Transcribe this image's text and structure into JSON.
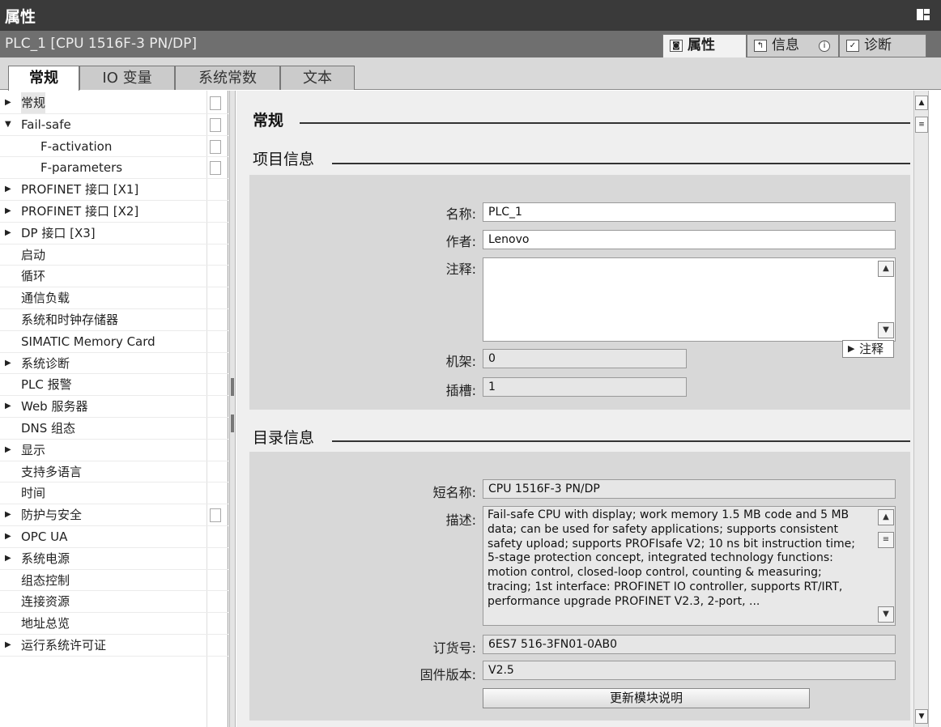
{
  "window": {
    "title": "属性"
  },
  "object_bar": {
    "object_name": "PLC_1 [CPU 1516F-3 PN/DP]",
    "tabs": [
      {
        "label": "属性",
        "icon": "properties-icon",
        "active": true
      },
      {
        "label": "信息",
        "icon": "info-icon",
        "active": false
      },
      {
        "label": "诊断",
        "icon": "diagnostics-icon",
        "active": false
      }
    ]
  },
  "tabs": [
    {
      "label": "常规",
      "active": true
    },
    {
      "label": "IO 变量",
      "active": false
    },
    {
      "label": "系统常数",
      "active": false
    },
    {
      "label": "文本",
      "active": false
    }
  ],
  "nav": {
    "items": [
      {
        "label": "常规",
        "arrow": "▶",
        "indent": 1,
        "selected": true,
        "checkbox": true
      },
      {
        "label": "Fail-safe",
        "arrow": "▼",
        "indent": 1,
        "selected": false,
        "checkbox": true
      },
      {
        "label": "F-activation",
        "arrow": "",
        "indent": 3,
        "selected": false,
        "checkbox": true
      },
      {
        "label": "F-parameters",
        "arrow": "",
        "indent": 3,
        "selected": false,
        "checkbox": true
      },
      {
        "label": "PROFINET 接口 [X1]",
        "arrow": "▶",
        "indent": 1,
        "selected": false,
        "checkbox": false
      },
      {
        "label": "PROFINET 接口 [X2]",
        "arrow": "▶",
        "indent": 1,
        "selected": false,
        "checkbox": false
      },
      {
        "label": "DP 接口 [X3]",
        "arrow": "▶",
        "indent": 1,
        "selected": false,
        "checkbox": false
      },
      {
        "label": "启动",
        "arrow": "",
        "indent": 2,
        "selected": false,
        "checkbox": false
      },
      {
        "label": "循环",
        "arrow": "",
        "indent": 2,
        "selected": false,
        "checkbox": false
      },
      {
        "label": "通信负载",
        "arrow": "",
        "indent": 2,
        "selected": false,
        "checkbox": false
      },
      {
        "label": "系统和时钟存储器",
        "arrow": "",
        "indent": 2,
        "selected": false,
        "checkbox": false
      },
      {
        "label": "SIMATIC Memory Card",
        "arrow": "",
        "indent": 2,
        "selected": false,
        "checkbox": false
      },
      {
        "label": "系统诊断",
        "arrow": "▶",
        "indent": 1,
        "selected": false,
        "checkbox": false
      },
      {
        "label": "PLC 报警",
        "arrow": "",
        "indent": 2,
        "selected": false,
        "checkbox": false
      },
      {
        "label": "Web 服务器",
        "arrow": "▶",
        "indent": 1,
        "selected": false,
        "checkbox": false
      },
      {
        "label": "DNS 组态",
        "arrow": "",
        "indent": 2,
        "selected": false,
        "checkbox": false
      },
      {
        "label": "显示",
        "arrow": "▶",
        "indent": 1,
        "selected": false,
        "checkbox": false
      },
      {
        "label": "支持多语言",
        "arrow": "",
        "indent": 2,
        "selected": false,
        "checkbox": false
      },
      {
        "label": "时间",
        "arrow": "",
        "indent": 2,
        "selected": false,
        "checkbox": false
      },
      {
        "label": "防护与安全",
        "arrow": "▶",
        "indent": 1,
        "selected": false,
        "checkbox": true
      },
      {
        "label": "OPC UA",
        "arrow": "▶",
        "indent": 1,
        "selected": false,
        "checkbox": false
      },
      {
        "label": "系统电源",
        "arrow": "▶",
        "indent": 1,
        "selected": false,
        "checkbox": false
      },
      {
        "label": "组态控制",
        "arrow": "",
        "indent": 2,
        "selected": false,
        "checkbox": false
      },
      {
        "label": "连接资源",
        "arrow": "",
        "indent": 2,
        "selected": false,
        "checkbox": false
      },
      {
        "label": "地址总览",
        "arrow": "",
        "indent": 2,
        "selected": false,
        "checkbox": false
      },
      {
        "label": "运行系统许可证",
        "arrow": "▶",
        "indent": 1,
        "selected": false,
        "checkbox": false
      }
    ]
  },
  "content": {
    "section_title": "常规",
    "project_info": {
      "heading": "项目信息",
      "name_label": "名称:",
      "name_value": "PLC_1",
      "author_label": "作者:",
      "author_value": "Lenovo",
      "comment_label": "注释:",
      "comment_value": "",
      "comment_button": "注释",
      "rack_label": "机架:",
      "rack_value": "0",
      "slot_label": "插槽:",
      "slot_value": "1"
    },
    "catalog_info": {
      "heading": "目录信息",
      "short_name_label": "短名称:",
      "short_name_value": "CPU 1516F-3 PN/DP",
      "description_label": "描述:",
      "description_value": "Fail-safe CPU with display; work memory 1.5 MB code and 5 MB data; can be used for safety applications; supports consistent safety upload; supports PROFIsafe V2; 10 ns bit instruction time; 5-stage protection concept, integrated technology functions: motion control, closed-loop control, counting & measuring; tracing; 1st interface: PROFINET IO controller, supports RT/IRT, performance upgrade PROFINET V2.3, 2-port, ...",
      "order_no_label": "订货号:",
      "order_no_value": "6ES7 516-3FN01-0AB0",
      "firmware_label": "固件版本:",
      "firmware_value": "V2.5",
      "update_button": "更新模块说明"
    }
  },
  "colors": {
    "titlebar": "#3a3a3a",
    "objbar": "#6f6f6f",
    "panel": "#efefef",
    "group": "#d8d8d8"
  }
}
